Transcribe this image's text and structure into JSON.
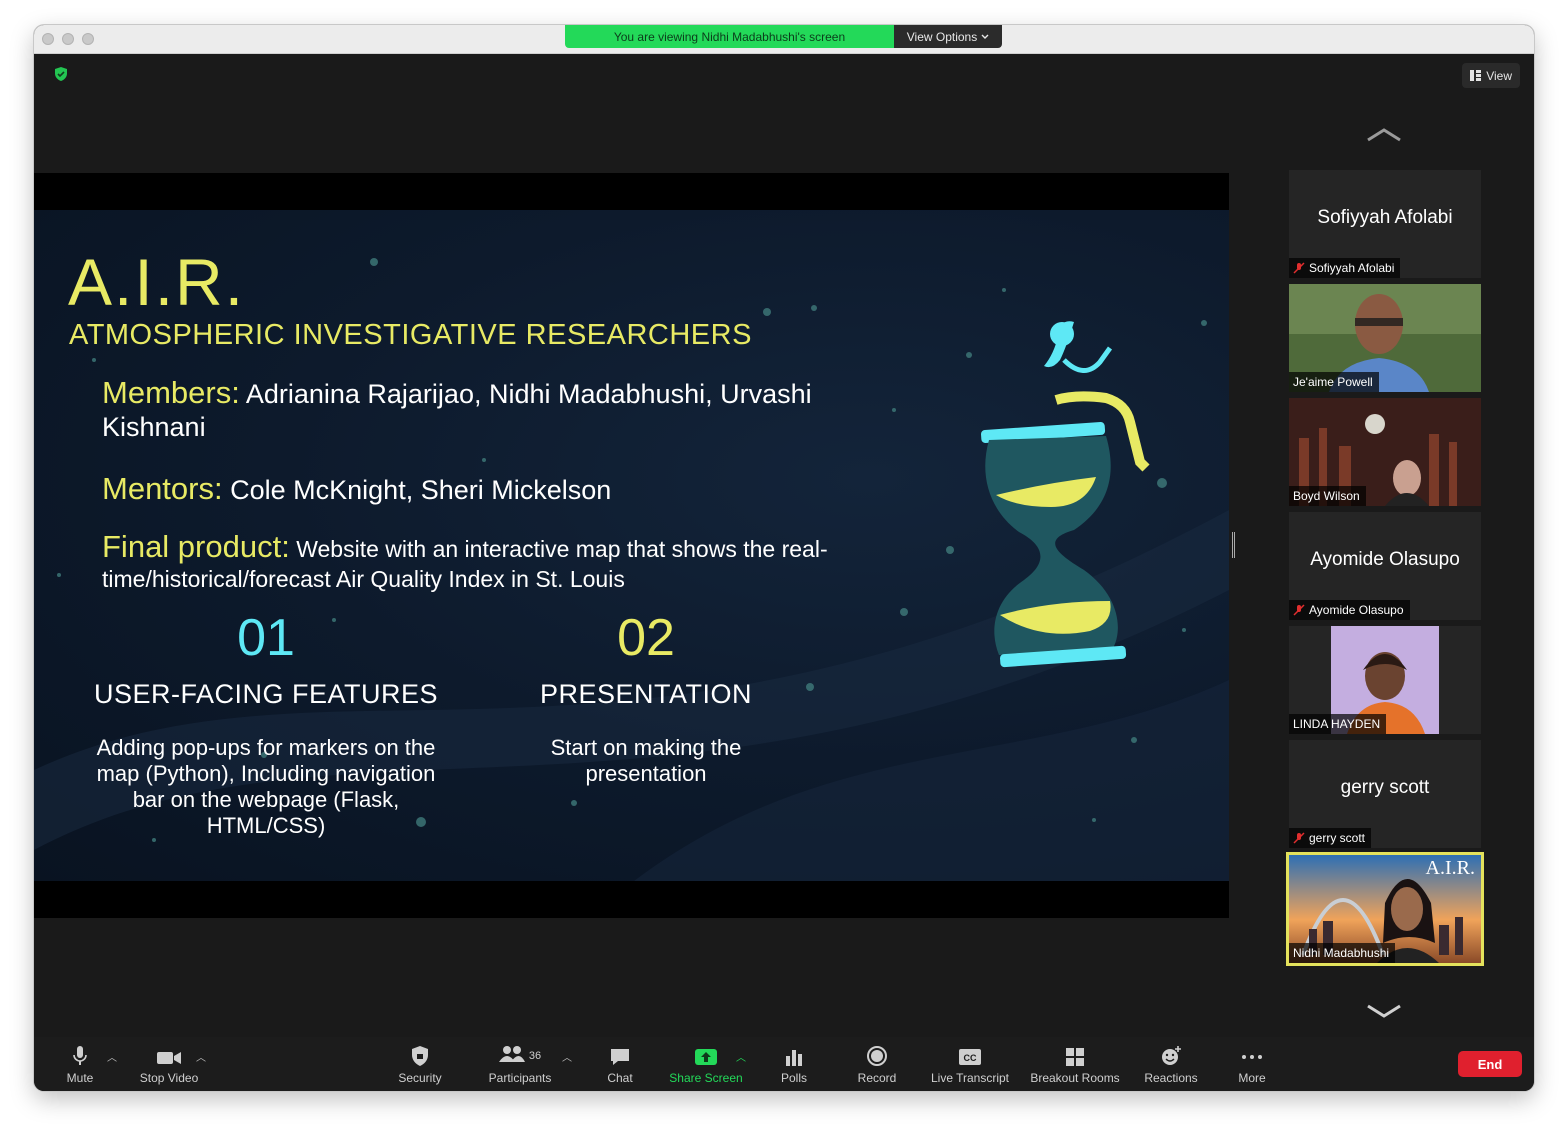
{
  "banner": {
    "message": "You are viewing Nidhi Madabhushi's screen",
    "view_options": "View Options"
  },
  "top_right": {
    "view_label": "View"
  },
  "slide": {
    "title": "A.I.R.",
    "subtitle": "ATMOSPHERIC INVESTIGATIVE RESEARCHERS",
    "members_label": "Members:",
    "members_value": "Adrianina Rajarijao, Nidhi Madabhushi, Urvashi Kishnani",
    "mentors_label": "Mentors:",
    "mentors_value": "Cole McKnight, Sheri Mickelson",
    "final_label": "Final product:",
    "final_value": "Website with an interactive map that shows the real-time/historical/forecast Air Quality Index in St. Louis",
    "col1": {
      "num": "01",
      "heading": "USER-FACING FEATURES",
      "body": "Adding pop-ups for markers on the map (Python), Including navigation bar on the webpage (Flask, HTML/CSS)"
    },
    "col2": {
      "num": "02",
      "heading": "PRESENTATION",
      "body": "Start on making the presentation"
    }
  },
  "participants": [
    {
      "display": "Sofiyyah Afolabi",
      "label": "Sofiyyah Afolabi",
      "muted": true,
      "video": false
    },
    {
      "label": "Je'aime Powell",
      "video": true
    },
    {
      "label": "Boyd Wilson",
      "video": true
    },
    {
      "display": "Ayomide Olasupo",
      "label": "Ayomide Olasupo",
      "muted": true,
      "video": false
    },
    {
      "label": "LINDA HAYDEN",
      "video": true
    },
    {
      "display": "gerry scott",
      "label": "gerry scott",
      "muted": true,
      "video": false
    },
    {
      "label": "Nidhi Madabhushi",
      "video": true,
      "speaking": true,
      "bg_text": "A.I.R."
    }
  ],
  "toolbar": {
    "mute": "Mute",
    "stop_video": "Stop Video",
    "security": "Security",
    "participants": "Participants",
    "participants_count": "36",
    "chat": "Chat",
    "share_screen": "Share Screen",
    "polls": "Polls",
    "record": "Record",
    "live_transcript": "Live Transcript",
    "breakout_rooms": "Breakout Rooms",
    "reactions": "Reactions",
    "more": "More",
    "end": "End"
  },
  "colors": {
    "accent_yellow": "#e8ea64",
    "accent_cyan": "#5ee8f5",
    "share_green": "#23d959",
    "end_red": "#e0202e"
  }
}
